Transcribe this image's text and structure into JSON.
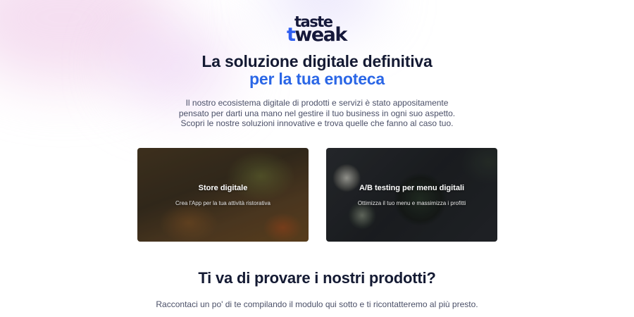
{
  "logo": {
    "line1": "taste",
    "line2_accent": "t",
    "line2_rest": "weak",
    "colors": {
      "text": "#15183a",
      "accent": "#2f5ef0"
    }
  },
  "hero": {
    "title_line1": "La soluzione digitale definitiva",
    "title_line2": "per la tua enoteca",
    "highlight_color": "#2a66e6"
  },
  "intro": {
    "lines": [
      "Il nostro ecosistema digitale di prodotti e servizi è stato appositamente",
      "pensato per darti una mano nel gestire il tuo business in ogni suo aspetto.",
      "Scopri le nostre soluzioni innovative e trova quelle che fanno al caso tuo."
    ]
  },
  "cards": [
    {
      "title": "Store digitale",
      "subtitle": "Crea l'App per la tua attività ristorativa"
    },
    {
      "title": "A/B testing per menu digitali",
      "subtitle": "Ottimizza il tuo menu e massimizza i profitti"
    }
  ],
  "cta": {
    "title": "Ti va di provare i nostri prodotti?",
    "subtitle": "Raccontaci un po' di te compilando il modulo qui sotto e ti ricontatteremo al più presto."
  }
}
